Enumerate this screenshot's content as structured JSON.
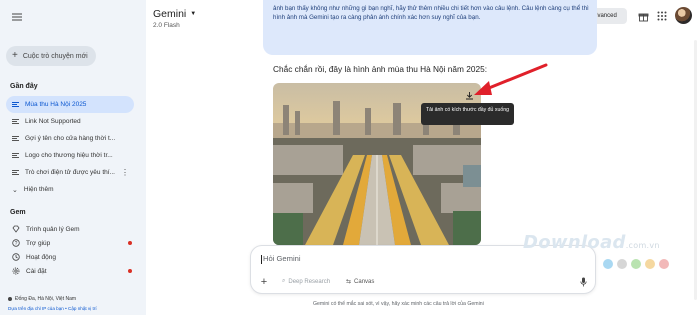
{
  "sidebar": {
    "new_chat": "Cuộc trò chuyện mới",
    "recent_title": "Gần đây",
    "recent": [
      {
        "label": "Mùa thu Hà Nội 2025",
        "active": true
      },
      {
        "label": "Link Not Supported",
        "active": false
      },
      {
        "label": "Gợi ý tên cho cửa hàng thời t...",
        "active": false
      },
      {
        "label": "Logo cho thương hiệu thời tr...",
        "active": false
      },
      {
        "label": "Trò chơi điện tử được yêu thí...",
        "active": false
      }
    ],
    "show_more": "Hiện thêm",
    "gem_title": "Gem",
    "gems": [
      {
        "label": "Trình quản lý Gem",
        "icon": "gem-manager-icon",
        "dot": false
      },
      {
        "label": "Trợ giúp",
        "icon": "help-icon",
        "dot": true
      },
      {
        "label": "Hoạt động",
        "icon": "activity-icon",
        "dot": false
      },
      {
        "label": "Cài đặt",
        "icon": "settings-icon",
        "dot": true
      }
    ],
    "location": "Đống Đa, Hà Nội, Việt Nam",
    "location_link": "Dựa trên địa chỉ IP của bạn • Cập nhật vị trí"
  },
  "header": {
    "title": "Gemini",
    "model": "2.0 Flash",
    "try_advanced": "Dùng thử Gemini Advanced"
  },
  "conversation": {
    "bubble_text": "ảnh bạn thấy không như những gì bạn nghĩ, hãy thử thêm nhiều chi tiết hơn vào câu lệnh. Câu lệnh càng cụ thể thì hình ảnh mà Gemini tạo ra càng phản ánh chính xác hơn suy nghĩ của bạn.",
    "reply": "Chắc chắn rồi, đây là hình ảnh mùa thu Hà Nội năm 2025:",
    "tooltip": "Tải ảnh có kích thước đầy đủ xuống"
  },
  "composer": {
    "placeholder": "Hỏi Gemini",
    "deep_research": "Deep Research",
    "canvas": "Canvas"
  },
  "disclaimer": "Gemini có thể mắc sai sót, vì vậy, hãy xác minh các câu trả lời của Gemini",
  "watermark": {
    "name": "Download",
    "tld": ".com.vn"
  },
  "colors": {
    "sidebar_bg": "#f0f4f9",
    "active_bg": "#d3e3fd",
    "accent": "#0b57d0",
    "bubble_bg": "#dde8fb",
    "arrow": "#e0202a",
    "watermark_dots": [
      "#a9d8f2",
      "#d6d6d6",
      "#b9e3b0",
      "#f5d8a0",
      "#f2b8b8"
    ]
  }
}
